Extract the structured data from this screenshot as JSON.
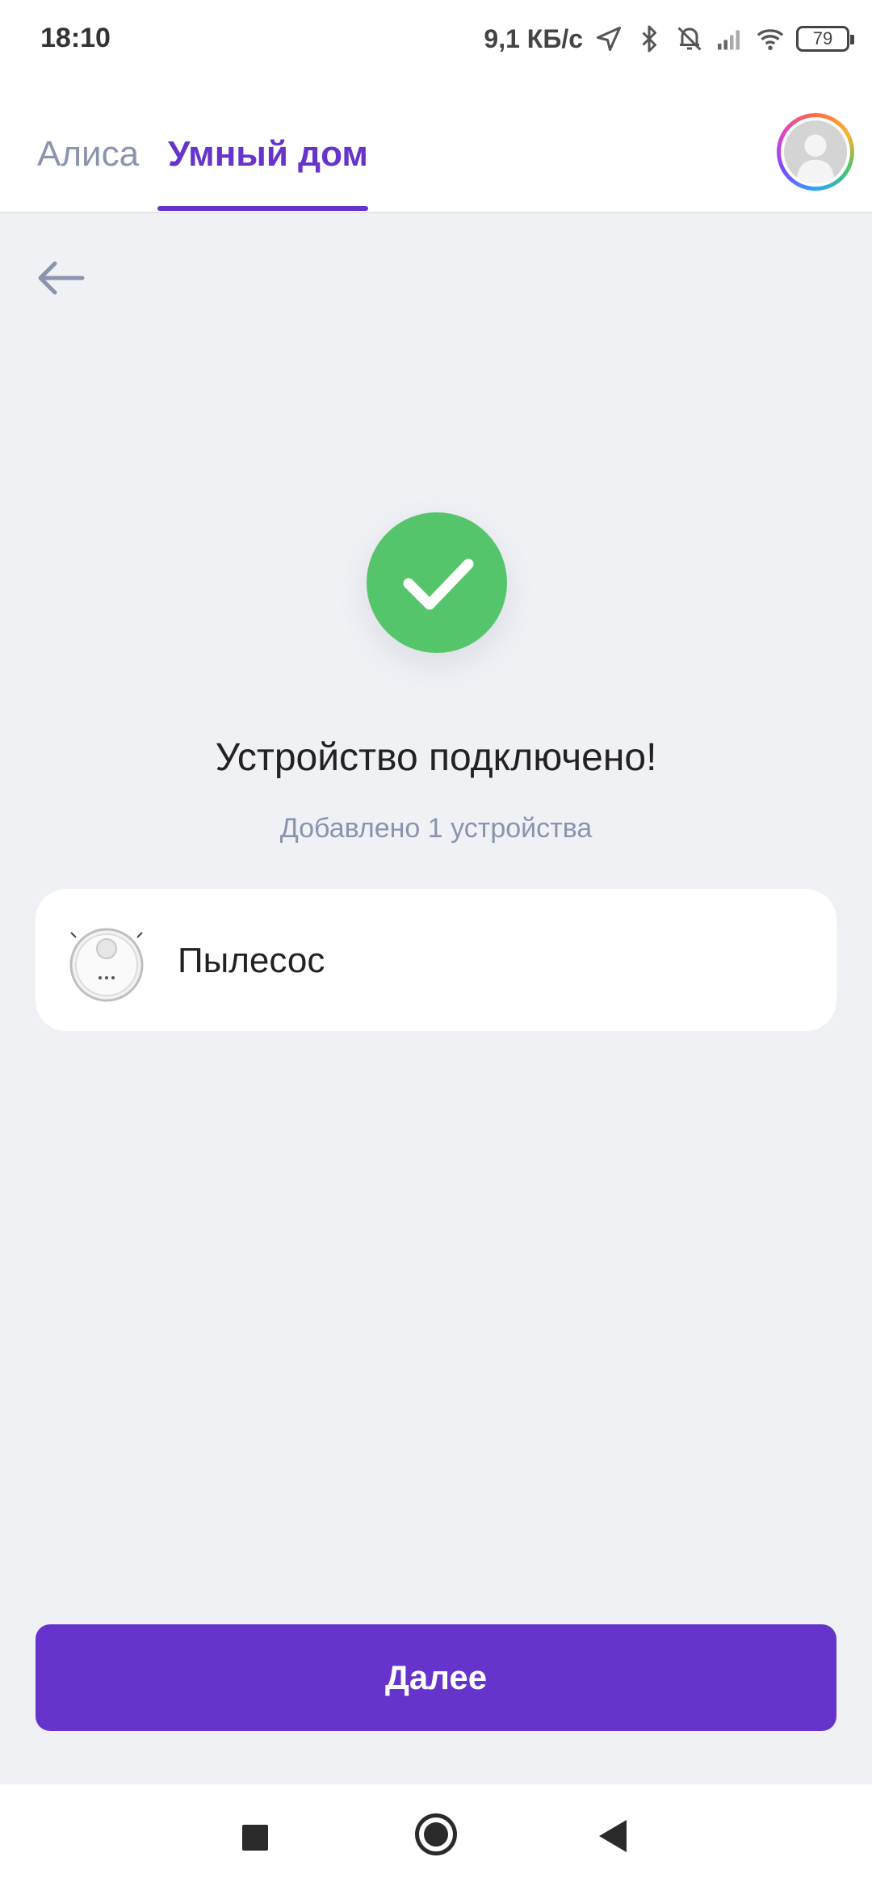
{
  "status_bar": {
    "time": "18:10",
    "net_speed": "9,1 КБ/с",
    "battery": "79",
    "icons": [
      "location-icon",
      "bluetooth-icon",
      "mute-icon",
      "signal-icon",
      "wifi-icon",
      "battery-icon"
    ]
  },
  "header": {
    "tabs": [
      {
        "label": "Алиса",
        "active": false
      },
      {
        "label": "Умный дом",
        "active": true
      }
    ],
    "accent_color": "#6633cc"
  },
  "main": {
    "title": "Устройство подключено!",
    "subtitle": "Добавлено 1 устройства",
    "success_color": "#55c56b",
    "devices": [
      {
        "name": "Пылесос",
        "icon": "robot-vacuum-icon"
      }
    ]
  },
  "footer": {
    "next_label": "Далее"
  }
}
